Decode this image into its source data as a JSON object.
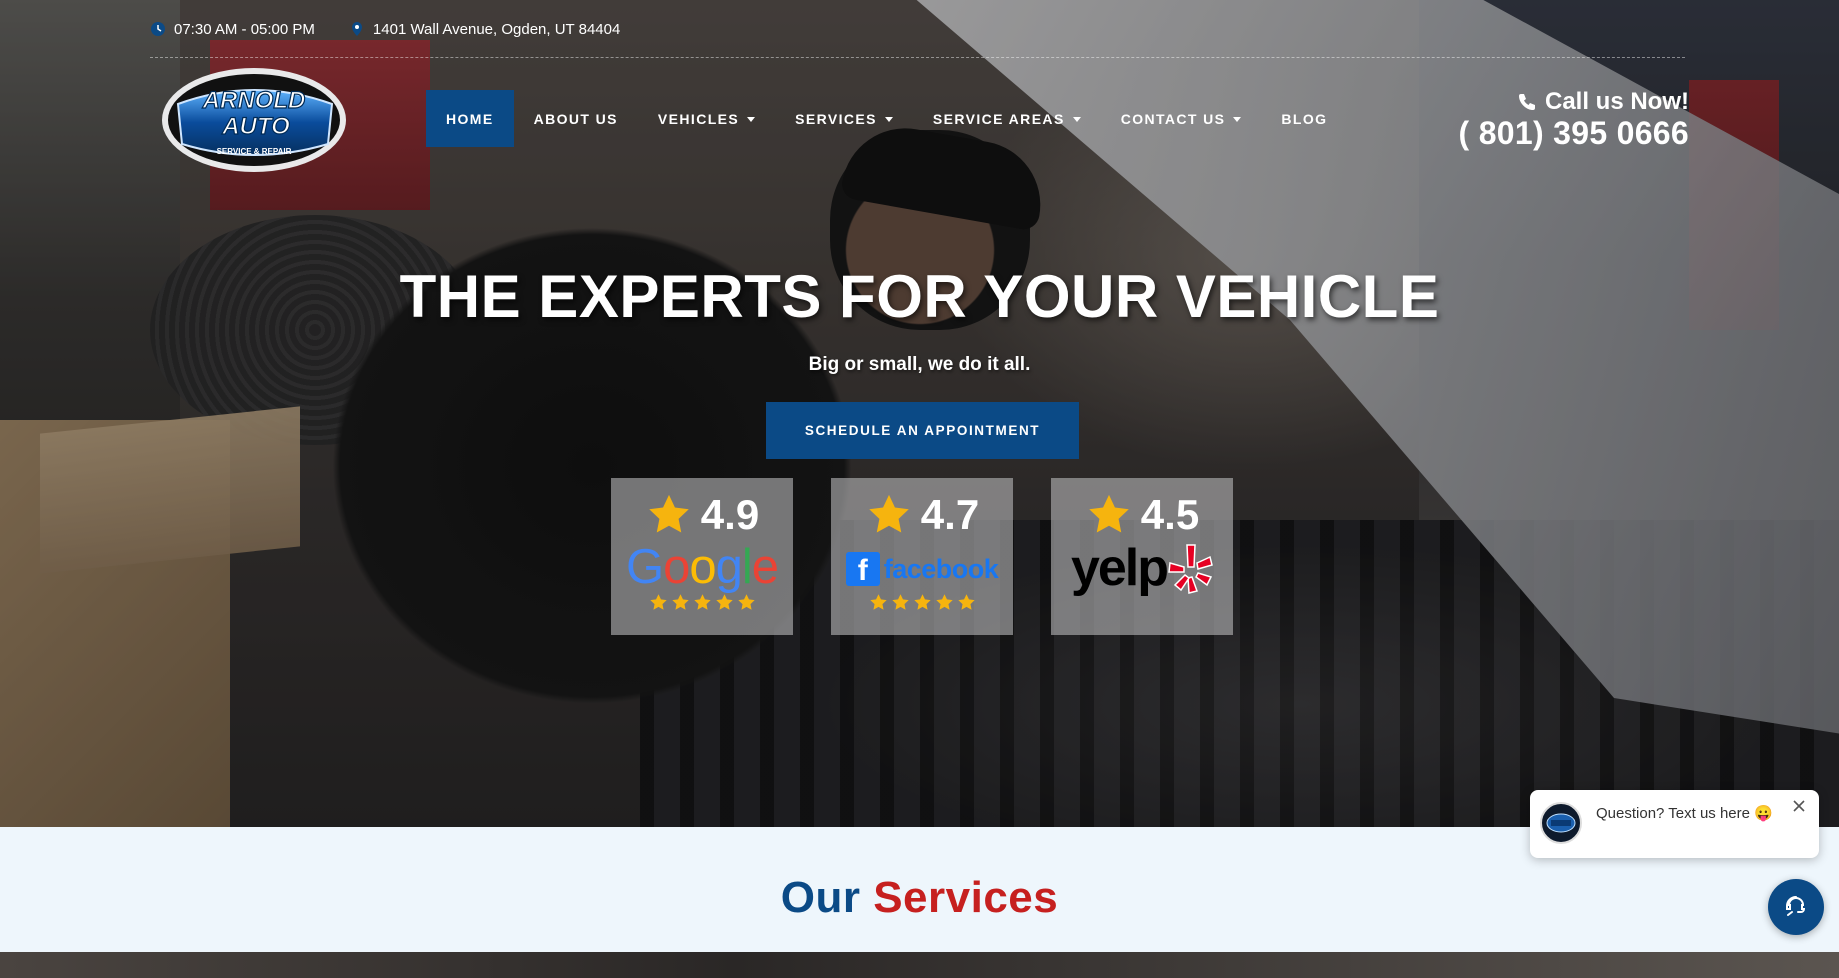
{
  "topbar": {
    "hours": "07:30 AM - 05:00 PM",
    "address": "1401 Wall Avenue, Ogden, UT 84404"
  },
  "logo": {
    "line1": "ARNOLD",
    "line2": "AUTO",
    "tagline": "SERVICE & REPAIR"
  },
  "nav": {
    "items": [
      {
        "label": "HOME",
        "active": true,
        "dropdown": false
      },
      {
        "label": "ABOUT US",
        "active": false,
        "dropdown": false
      },
      {
        "label": "VEHICLES",
        "active": false,
        "dropdown": true
      },
      {
        "label": "SERVICES",
        "active": false,
        "dropdown": true
      },
      {
        "label": "SERVICE AREAS",
        "active": false,
        "dropdown": true
      },
      {
        "label": "CONTACT US",
        "active": false,
        "dropdown": true
      },
      {
        "label": "BLOG",
        "active": false,
        "dropdown": false
      }
    ]
  },
  "call": {
    "label": "Call us Now!",
    "number": "( 801) 395 0666"
  },
  "hero": {
    "headline": "THE EXPERTS FOR YOUR VEHICLE",
    "subhead": "Big or small, we do it all.",
    "cta": "SCHEDULE AN APPOINTMENT"
  },
  "ratings": [
    {
      "score": "4.9",
      "brand": "Google"
    },
    {
      "score": "4.7",
      "brand": "facebook"
    },
    {
      "score": "4.5",
      "brand": "yelp"
    }
  ],
  "services": {
    "title_part1": "Our",
    "title_part2": "Services"
  },
  "chat": {
    "message": "Question? Text us here 😛"
  },
  "colors": {
    "brand_blue": "#0b4a86",
    "brand_red": "#c6201f",
    "star_gold": "#f6b40e",
    "services_bg": "#eef6fc"
  }
}
